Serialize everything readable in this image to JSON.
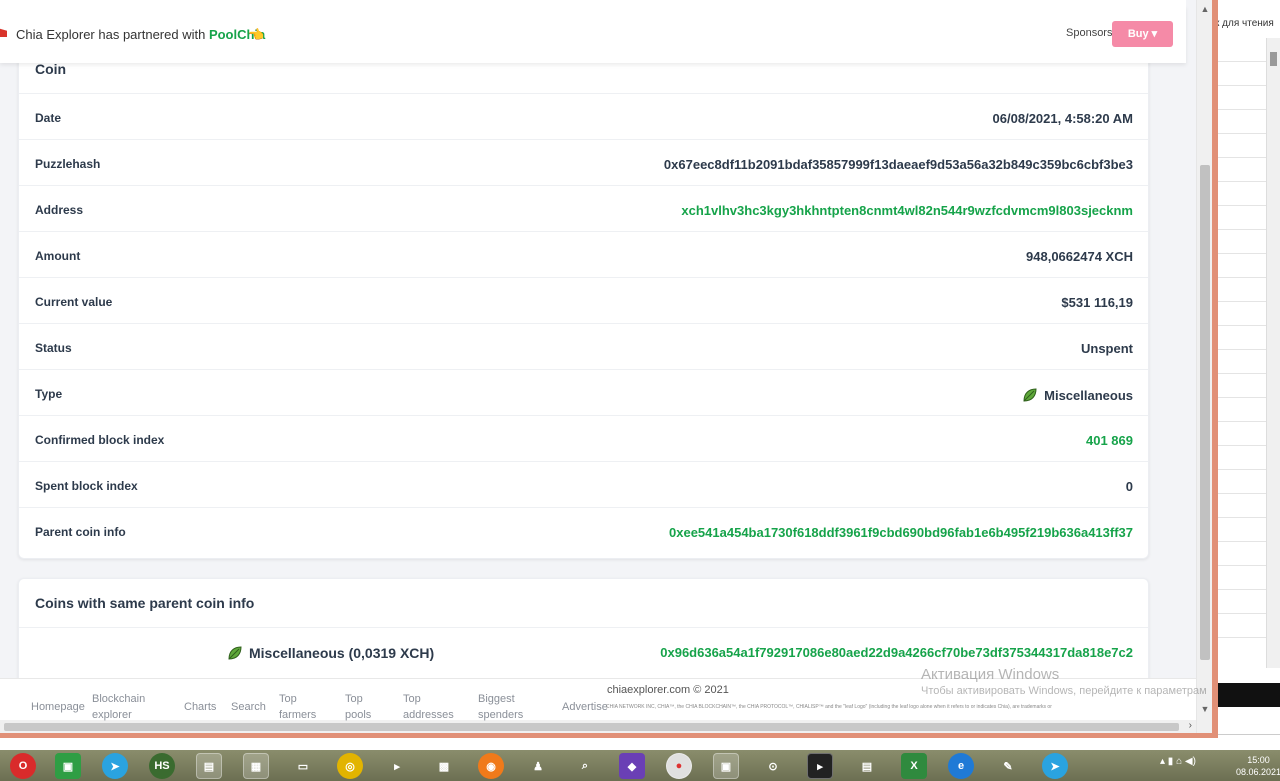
{
  "banner": {
    "text": "Chia Explorer has partnered with ",
    "partner": "PoolChia",
    "sponsors_label": "Sponsors:",
    "buy_label": "Buy ▾"
  },
  "coin_card": {
    "title": "Coin",
    "rows": [
      {
        "label": "Date",
        "value": "06/08/2021, 4:58:20 AM"
      },
      {
        "label": "Puzzlehash",
        "value": "0x67eec8df11b2091bdaf35857999f13daeaef9d53a56a32b849c359bc6cbf3be3"
      },
      {
        "label": "Address",
        "value": "xch1vlhv3hc3kgy3hkhntpten8cnmt4wl82n544r9wzfcdvmcm9l803sjecknm"
      },
      {
        "label": "Amount",
        "value": "948,0662474 XCH"
      },
      {
        "label": "Current value",
        "value": "$531 116,19"
      },
      {
        "label": "Status",
        "value": "Unspent"
      },
      {
        "label": "Type",
        "value": "Miscellaneous"
      },
      {
        "label": "Confirmed block index",
        "value": "401 869"
      },
      {
        "label": "Spent block index",
        "value": "0"
      },
      {
        "label": "Parent coin info",
        "value": "0xee541a454ba1730f618ddf3961f9cbd690bd96fab1e6b495f219b636a413ff37"
      }
    ]
  },
  "same_parent": {
    "title": "Coins with same parent coin info",
    "type": "Miscellaneous (0,0319 XCH)",
    "hash": "0x96d636a54a1f792917086e80aed22d9a4266cf70be73df375344317da818e7c2"
  },
  "footer": {
    "nav": [
      "Homepage",
      "Blockchain explorer",
      "Charts",
      "Search",
      "Top farmers",
      "Top pools",
      "Top addresses",
      "Biggest spenders",
      "Advertise"
    ],
    "copyright": "chiaexplorer.com © 2021",
    "legal": "CHIA NETWORK INC, CHIA™, the CHIA BLOCKCHAIN™, the CHIA PROTOCOL™, CHIALISP™ and the \"leaf Logo\" (including the leaf logo alone when it refers to or indicates Chia), are trademarks or"
  },
  "activation": {
    "title": "Активация Windows",
    "subtitle": "Чтобы активировать Windows, перейдите к параметрам"
  },
  "background": {
    "reading_mode": "к для чтения"
  },
  "taskbar": {
    "clock_time": "15:00",
    "clock_date": "08.06.2021"
  },
  "colors": {
    "accent_green": "#16a34a",
    "text_dark": "#2d3a4b",
    "buy_pink": "#f58aa7",
    "browser_border": "#e19077"
  }
}
